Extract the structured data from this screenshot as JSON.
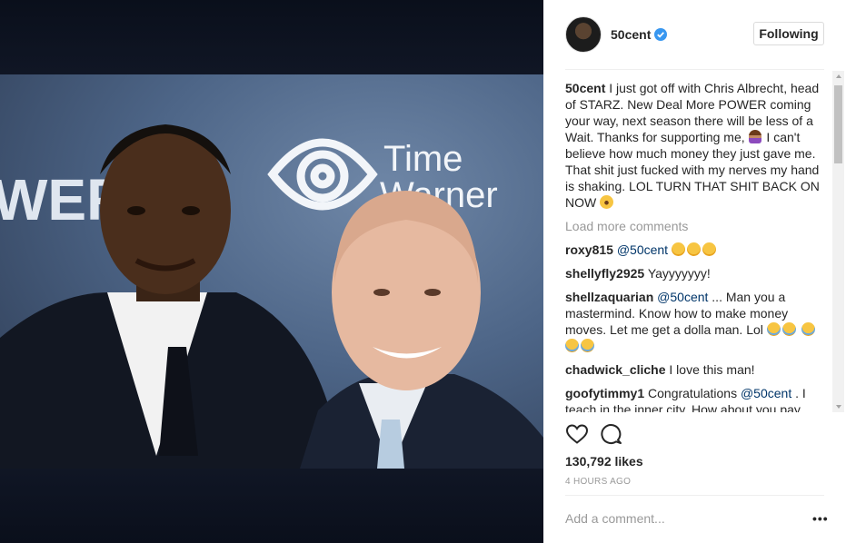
{
  "post": {
    "username": "50cent",
    "follow_label": "Following",
    "photo": {
      "logo_line1": "Time",
      "logo_line2": "Warner",
      "backdrop_text": "WER"
    }
  },
  "caption": {
    "username": "50cent",
    "text1": "I just got off with Chris Albrecht, head of STARZ. New Deal More POWER coming your way, next season there will be less of a Wait. Thanks for supporting me,",
    "text2": "I can't believe how much money they just gave me. That shit just fucked with my nerves my hand is shaking. LOL TURN THAT SHIT BACK ON NOW"
  },
  "load_more": "Load more comments",
  "comments": [
    {
      "user": "roxy815",
      "mention": "@50cent",
      "text": ""
    },
    {
      "user": "shellyfly2925",
      "mention": "",
      "text": "Yayyyyyyy!"
    },
    {
      "user": "shellzaquarian",
      "mention": "@50cent",
      "text": "... Man you a mastermind. Know how to make money moves. Let me get a dolla man. Lol"
    },
    {
      "user": "chadwick_cliche",
      "mention": "",
      "text": "I love this man!"
    },
    {
      "user": "goofytimmy1",
      "pre": "Congratulations",
      "mention": "@50cent",
      "text": ". I teach in the inner city. How about you pay"
    }
  ],
  "likes": "130,792 likes",
  "time": "4 HOURS AGO",
  "add_comment_placeholder": "Add a comment...",
  "more_label": "•••",
  "colors": {
    "link": "#003569",
    "verified": "#3897f0",
    "muted": "#999999"
  },
  "icons": [
    "verified-icon",
    "heart-icon",
    "comment-icon",
    "more-options-icon"
  ]
}
